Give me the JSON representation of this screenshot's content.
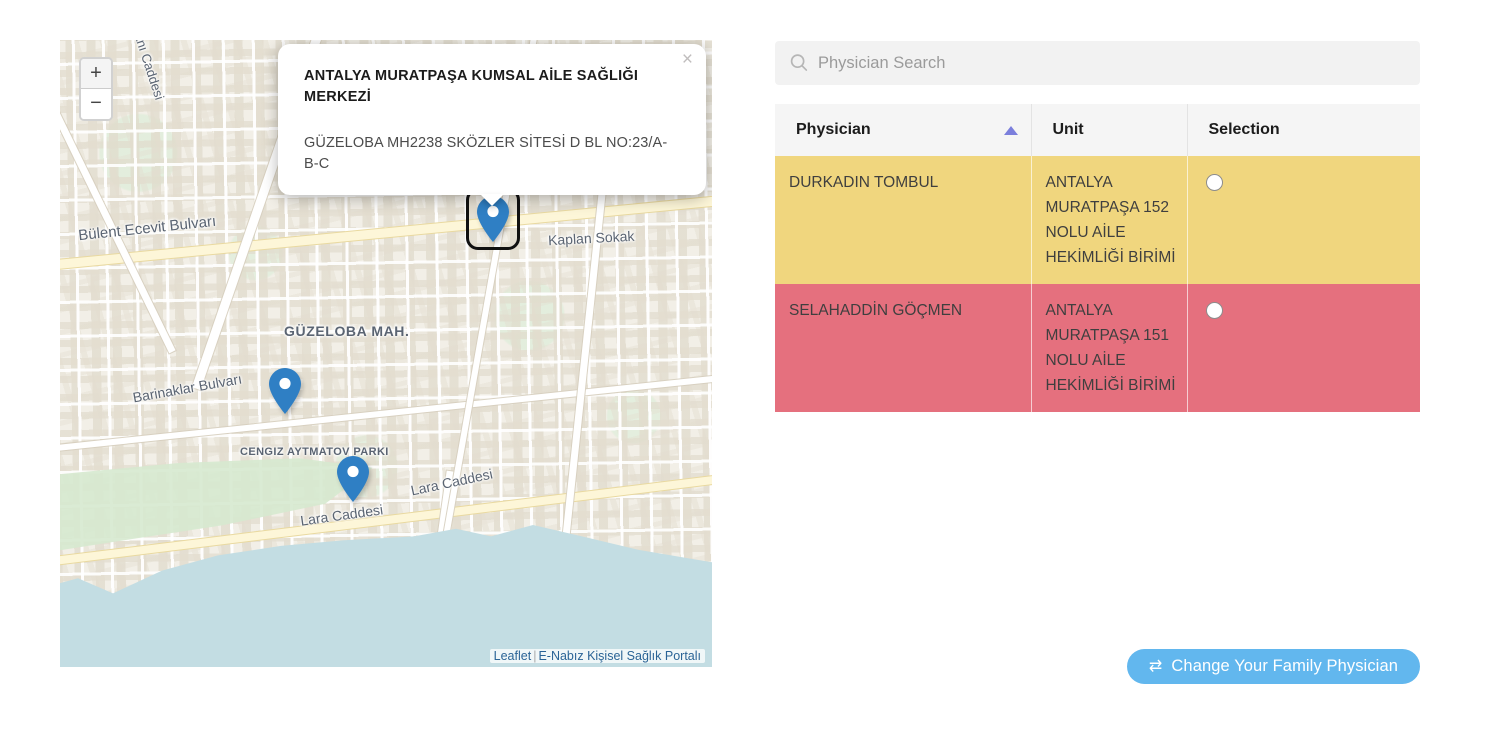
{
  "map": {
    "popup": {
      "title": "ANTALYA MURATPAŞA KUMSAL AİLE SAĞLIĞI MERKEZİ",
      "address": "GÜZELOBA MH2238 SKÖZLER SİTESİ D BL NO:23/A-B-C",
      "close_label": "×"
    },
    "zoom": {
      "in_label": "+",
      "out_label": "−"
    },
    "attribution": {
      "leaflet": "Leaflet",
      "separator": "|",
      "provider": "E-Nabız Kişisel Sağlık Portalı"
    },
    "labels": {
      "bulent_ecevit": "Bülent Ecevit Bulvarı",
      "kaplan_sokak": "Kaplan Sokak",
      "havaalani": "alanı Caddesi",
      "guzeloba": "GÜZELOBA MAH.",
      "barinaklar": "Barinaklar Bulvarı",
      "cengiz_aytmatov": "CENGIZ AYTMATOV PARKI",
      "lara_1": "Lara Caddesi",
      "lara_2": "Lara Caddesi"
    },
    "markers": [
      {
        "name": "marker-guzeloba",
        "selected": false
      },
      {
        "name": "marker-lara",
        "selected": false
      },
      {
        "name": "marker-kumsal-asm",
        "selected": true
      }
    ]
  },
  "search": {
    "placeholder": "Physician Search",
    "value": "",
    "icon": "search-icon"
  },
  "table": {
    "columns": [
      {
        "label": "Physician",
        "sorted": "asc"
      },
      {
        "label": "Unit",
        "sorted": "none"
      },
      {
        "label": "Selection",
        "sorted": "none"
      }
    ],
    "rows": [
      {
        "physician": "DURKADIN TOMBUL",
        "unit": "ANTALYA MURATPAŞA 152 NOLU AİLE HEKİMLİĞİ BİRİMİ",
        "selected": false,
        "row_color": "#f0d67e"
      },
      {
        "physician": "SELAHADDİN GÖÇMEN",
        "unit": "ANTALYA MURATPAŞA 151 NOLU AİLE HEKİMLİĞİ BİRİMİ",
        "selected": false,
        "row_color": "#e5707e"
      }
    ]
  },
  "actions": {
    "change_physician_label": "Change Your Family Physician",
    "change_physician_icon": "⇄"
  },
  "colors": {
    "accent_blue": "#62b7ee",
    "row_yellow": "#f0d67e",
    "row_red": "#e5707e",
    "sort_arrow": "#7b7fdc",
    "marker_blue": "#2f7fc4",
    "link": "#2a6496"
  }
}
